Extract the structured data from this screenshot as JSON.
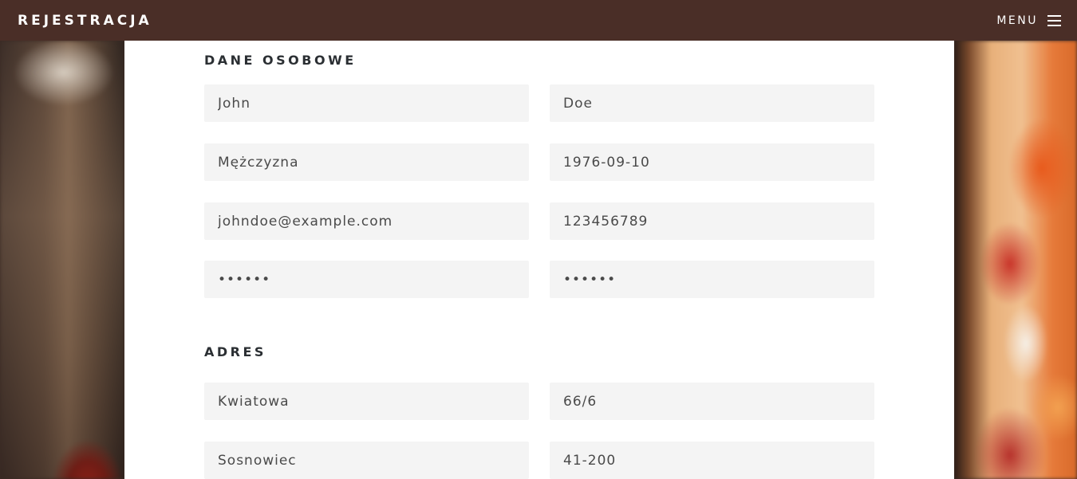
{
  "header": {
    "title": "REJESTRACJA",
    "menu_label": "MENU"
  },
  "personal": {
    "heading": "DANE OSOBOWE",
    "first_name": "John",
    "last_name": "Doe",
    "gender": "Mężczyzna",
    "birth_date": "1976-09-10",
    "email": "johndoe@example.com",
    "phone": "123456789",
    "password": "••••••",
    "password_confirm": "••••••"
  },
  "address": {
    "heading": "ADRES",
    "street": "Kwiatowa",
    "house_number": "66/6",
    "city": "Sosnowiec",
    "postal_code": "41-200"
  },
  "colors": {
    "topbar": "#4a2e27",
    "field_bg": "#f4f4f4",
    "heading": "#2b2f33"
  }
}
